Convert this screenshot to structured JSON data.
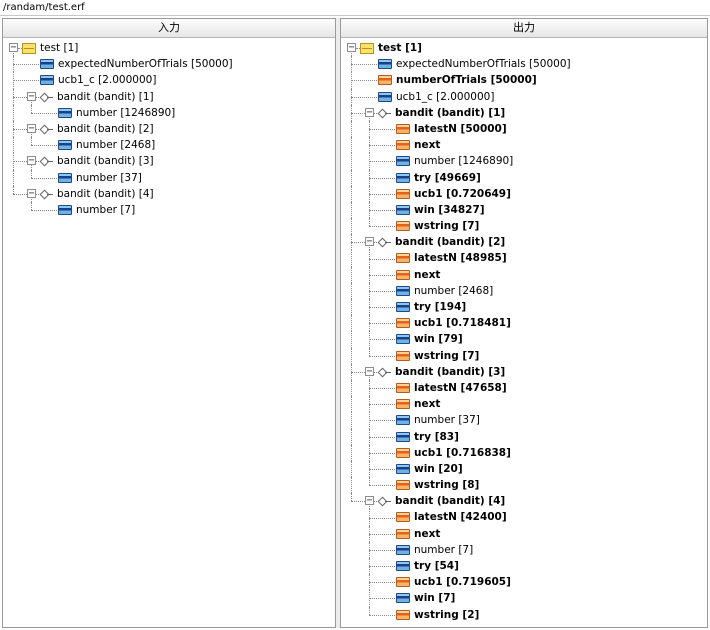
{
  "path": "/randam/test.erf",
  "input_pane": {
    "header": "入力",
    "rows": [
      {
        "depth": 0,
        "icon": "root",
        "label": "test [1]",
        "bold": false,
        "expander": "minus"
      },
      {
        "depth": 1,
        "icon": "blue",
        "label": "expectedNumberOfTrials [50000]",
        "bold": false
      },
      {
        "depth": 1,
        "icon": "blue",
        "label": "ucb1_c [2.000000]",
        "bold": false
      },
      {
        "depth": 1,
        "icon": "diamond",
        "label": "bandit (bandit) [1]",
        "bold": false,
        "expander": "minus"
      },
      {
        "depth": 2,
        "icon": "blue",
        "label": "number [1246890]",
        "bold": false
      },
      {
        "depth": 1,
        "icon": "diamond",
        "label": "bandit (bandit) [2]",
        "bold": false,
        "expander": "minus"
      },
      {
        "depth": 2,
        "icon": "blue",
        "label": "number [2468]",
        "bold": false
      },
      {
        "depth": 1,
        "icon": "diamond",
        "label": "bandit (bandit) [3]",
        "bold": false,
        "expander": "minus"
      },
      {
        "depth": 2,
        "icon": "blue",
        "label": "number [37]",
        "bold": false
      },
      {
        "depth": 1,
        "icon": "diamond",
        "label": "bandit (bandit) [4]",
        "bold": false,
        "expander": "minus"
      },
      {
        "depth": 2,
        "icon": "blue",
        "label": "number [7]",
        "bold": false
      }
    ]
  },
  "output_pane": {
    "header": "出力",
    "rows": [
      {
        "depth": 0,
        "icon": "root",
        "label": "test [1]",
        "bold": true,
        "expander": "minus"
      },
      {
        "depth": 1,
        "icon": "blue",
        "label": "expectedNumberOfTrials [50000]",
        "bold": false
      },
      {
        "depth": 1,
        "icon": "orange",
        "label": "numberOfTrials [50000]",
        "bold": true
      },
      {
        "depth": 1,
        "icon": "blue",
        "label": "ucb1_c [2.000000]",
        "bold": false
      },
      {
        "depth": 1,
        "icon": "diamond",
        "label": "bandit (bandit) [1]",
        "bold": true,
        "expander": "minus"
      },
      {
        "depth": 2,
        "icon": "orange",
        "label": "latestN [50000]",
        "bold": true
      },
      {
        "depth": 2,
        "icon": "orange",
        "label": "next",
        "bold": true
      },
      {
        "depth": 2,
        "icon": "blue",
        "label": "number [1246890]",
        "bold": false
      },
      {
        "depth": 2,
        "icon": "blue",
        "label": "try [49669]",
        "bold": true
      },
      {
        "depth": 2,
        "icon": "orange",
        "label": "ucb1 [0.720649]",
        "bold": true
      },
      {
        "depth": 2,
        "icon": "blue",
        "label": "win [34827]",
        "bold": true
      },
      {
        "depth": 2,
        "icon": "orange",
        "label": "wstring [7]",
        "bold": true
      },
      {
        "depth": 1,
        "icon": "diamond",
        "label": "bandit (bandit) [2]",
        "bold": true,
        "expander": "minus"
      },
      {
        "depth": 2,
        "icon": "orange",
        "label": "latestN [48985]",
        "bold": true
      },
      {
        "depth": 2,
        "icon": "orange",
        "label": "next",
        "bold": true
      },
      {
        "depth": 2,
        "icon": "blue",
        "label": "number [2468]",
        "bold": false
      },
      {
        "depth": 2,
        "icon": "blue",
        "label": "try [194]",
        "bold": true
      },
      {
        "depth": 2,
        "icon": "orange",
        "label": "ucb1 [0.718481]",
        "bold": true
      },
      {
        "depth": 2,
        "icon": "blue",
        "label": "win [79]",
        "bold": true
      },
      {
        "depth": 2,
        "icon": "orange",
        "label": "wstring [7]",
        "bold": true
      },
      {
        "depth": 1,
        "icon": "diamond",
        "label": "bandit (bandit) [3]",
        "bold": true,
        "expander": "minus"
      },
      {
        "depth": 2,
        "icon": "orange",
        "label": "latestN [47658]",
        "bold": true
      },
      {
        "depth": 2,
        "icon": "orange",
        "label": "next",
        "bold": true
      },
      {
        "depth": 2,
        "icon": "blue",
        "label": "number [37]",
        "bold": false
      },
      {
        "depth": 2,
        "icon": "blue",
        "label": "try [83]",
        "bold": true
      },
      {
        "depth": 2,
        "icon": "orange",
        "label": "ucb1 [0.716838]",
        "bold": true
      },
      {
        "depth": 2,
        "icon": "blue",
        "label": "win [20]",
        "bold": true
      },
      {
        "depth": 2,
        "icon": "orange",
        "label": "wstring [8]",
        "bold": true
      },
      {
        "depth": 1,
        "icon": "diamond",
        "label": "bandit (bandit) [4]",
        "bold": true,
        "expander": "minus"
      },
      {
        "depth": 2,
        "icon": "orange",
        "label": "latestN [42400]",
        "bold": true
      },
      {
        "depth": 2,
        "icon": "orange",
        "label": "next",
        "bold": true
      },
      {
        "depth": 2,
        "icon": "blue",
        "label": "number [7]",
        "bold": false
      },
      {
        "depth": 2,
        "icon": "blue",
        "label": "try [54]",
        "bold": true
      },
      {
        "depth": 2,
        "icon": "orange",
        "label": "ucb1 [0.719605]",
        "bold": true
      },
      {
        "depth": 2,
        "icon": "blue",
        "label": "win [7]",
        "bold": true
      },
      {
        "depth": 2,
        "icon": "orange",
        "label": "wstring [2]",
        "bold": true
      }
    ]
  }
}
